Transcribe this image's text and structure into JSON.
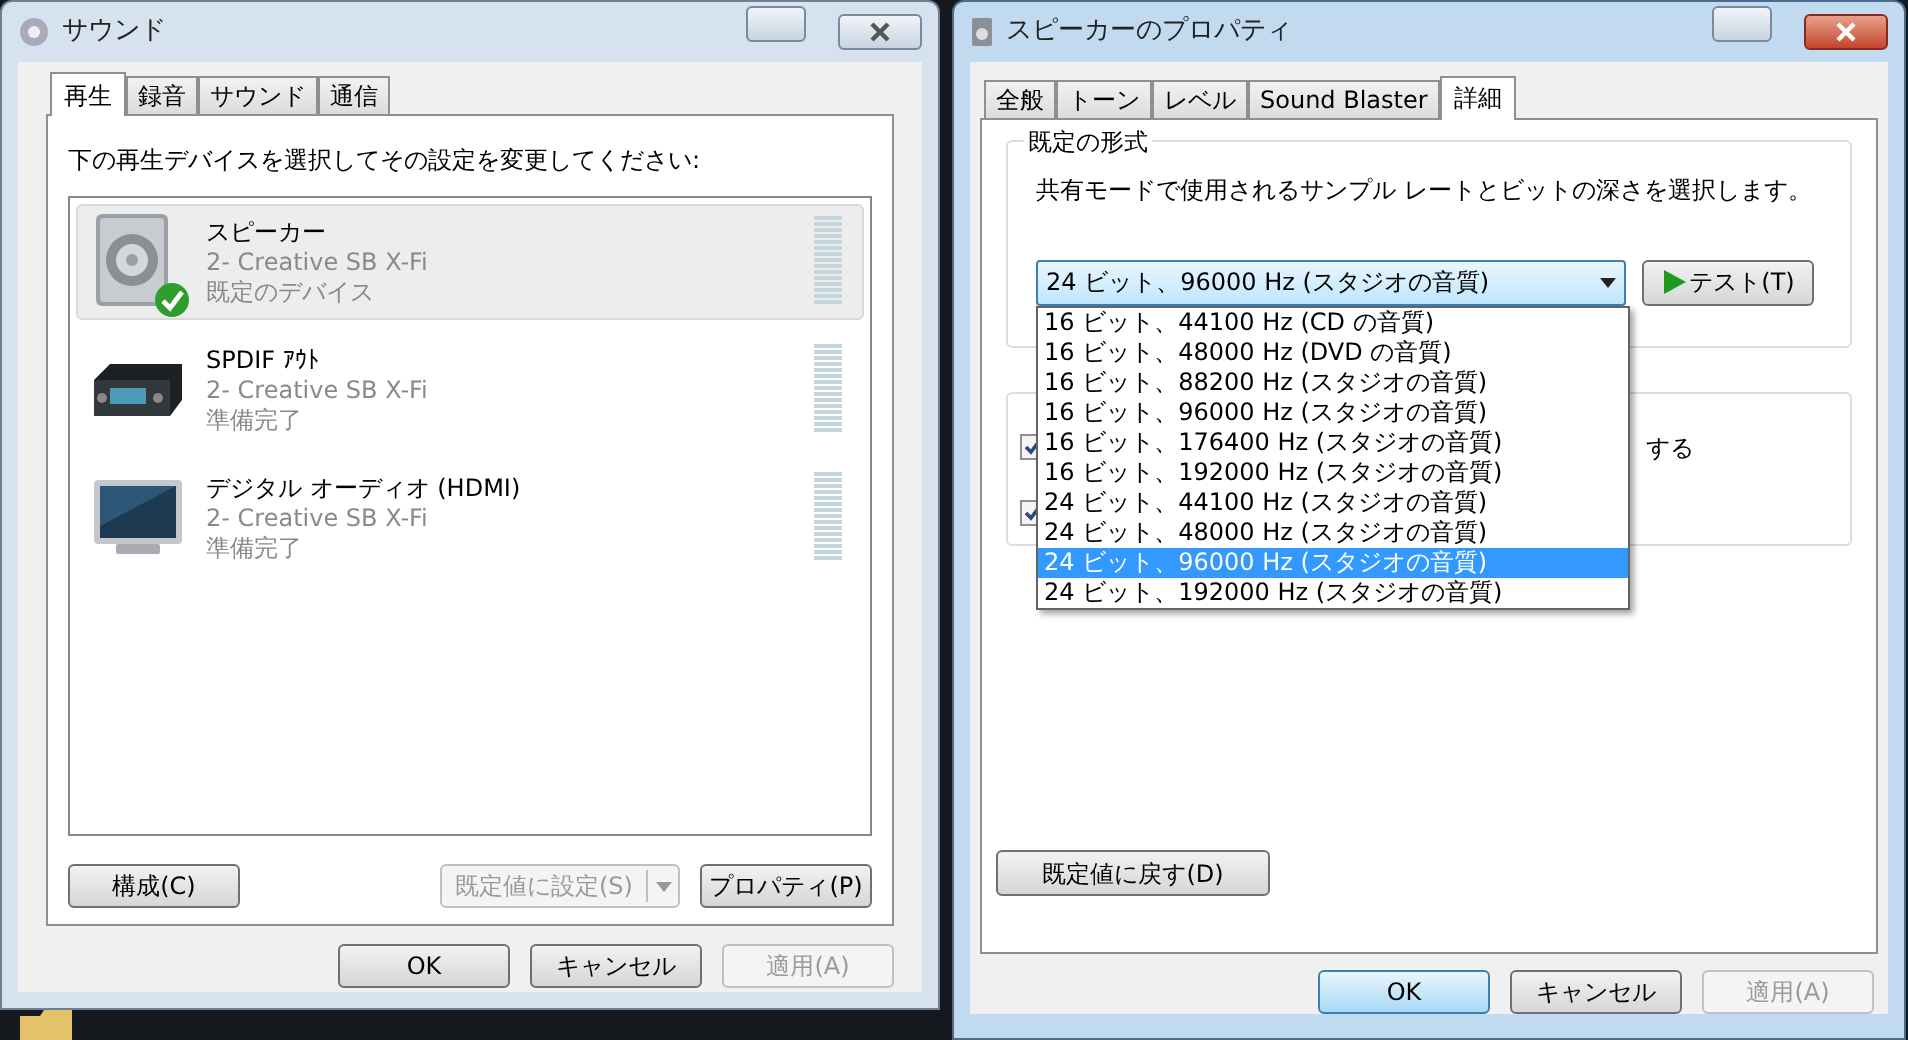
{
  "sound_window": {
    "title": "サウンド",
    "tabs": [
      {
        "label": "再生",
        "selected": true
      },
      {
        "label": "録音",
        "selected": false
      },
      {
        "label": "サウンド",
        "selected": false
      },
      {
        "label": "通信",
        "selected": false
      }
    ],
    "instruction": "下の再生デバイスを選択してその設定を変更してください:",
    "devices": [
      {
        "kind": "speaker",
        "name": "スピーカー",
        "driver": "2- Creative SB X-Fi",
        "status": "既定のデバイス",
        "selected": true,
        "default": true
      },
      {
        "kind": "receiver",
        "name": "SPDIF ｱｳﾄ",
        "driver": "2- Creative SB X-Fi",
        "status": "準備完了",
        "selected": false,
        "default": false
      },
      {
        "kind": "monitor",
        "name": "デジタル オーディオ (HDMI)",
        "driver": "2- Creative SB X-Fi",
        "status": "準備完了",
        "selected": false,
        "default": false
      }
    ],
    "configure_button": {
      "label": "構成(C)",
      "disabled": false
    },
    "set_default_button": {
      "label": "既定値に設定(S)",
      "disabled": true
    },
    "properties_button": {
      "label": "プロパティ(P)",
      "disabled": false
    },
    "dialog_buttons": [
      {
        "label": "OK",
        "disabled": false,
        "focused": false
      },
      {
        "label": "キャンセル",
        "disabled": false,
        "focused": false
      },
      {
        "label": "適用(A)",
        "disabled": true,
        "focused": false
      }
    ]
  },
  "properties_window": {
    "title": "スピーカーのプロパティ",
    "tabs": [
      {
        "label": "全般",
        "selected": false
      },
      {
        "label": "トーン",
        "selected": false
      },
      {
        "label": "レベル",
        "selected": false
      },
      {
        "label": "Sound Blaster",
        "selected": false
      },
      {
        "label": "詳細",
        "selected": true
      }
    ],
    "default_format": {
      "label": "既定の形式",
      "description": "共有モードで使用されるサンプル レートとビットの深さを選択します。",
      "value": "24 ビット、96000 Hz (スタジオの音質)",
      "test_button": "テスト(T)",
      "options": [
        {
          "label": "16 ビット、44100 Hz (CD の音質)",
          "selected": false
        },
        {
          "label": "16 ビット、48000 Hz (DVD の音質)",
          "selected": false
        },
        {
          "label": "16 ビット、88200 Hz (スタジオの音質)",
          "selected": false
        },
        {
          "label": "16 ビット、96000 Hz (スタジオの音質)",
          "selected": false
        },
        {
          "label": "16 ビット、176400 Hz (スタジオの音質)",
          "selected": false
        },
        {
          "label": "16 ビット、192000 Hz (スタジオの音質)",
          "selected": false
        },
        {
          "label": "24 ビット、44100 Hz (スタジオの音質)",
          "selected": false
        },
        {
          "label": "24 ビット、48000 Hz (スタジオの音質)",
          "selected": false
        },
        {
          "label": "24 ビット、96000 Hz (スタジオの音質)",
          "selected": true
        },
        {
          "label": "24 ビット、192000 Hz (スタジオの音質)",
          "selected": false
        }
      ]
    },
    "exclusive_group": {
      "checkboxes": [
        {
          "label": "する",
          "checked": true
        },
        {
          "checked": true
        }
      ]
    },
    "restore_button": "既定値に戻す(D)",
    "dialog_buttons": [
      {
        "label": "OK",
        "disabled": false,
        "focused": true
      },
      {
        "label": "キャンセル",
        "disabled": false,
        "focused": false
      },
      {
        "label": "適用(A)",
        "disabled": true,
        "focused": false
      }
    ]
  }
}
